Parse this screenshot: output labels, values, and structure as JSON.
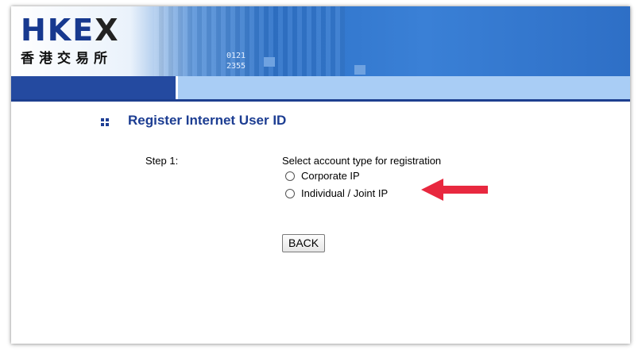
{
  "header": {
    "logo_text": "HKE",
    "logo_x": "X",
    "logo_chinese": "香港交易所",
    "ticker_line1": "0121",
    "ticker_line2": "2355"
  },
  "page": {
    "title": "Register Internet User ID",
    "step_label": "Step 1:",
    "prompt": "Select account type for registration",
    "options": [
      {
        "label": "Corporate IP",
        "selected": false
      },
      {
        "label": "Individual / Joint IP",
        "selected": false
      }
    ],
    "back_label": "BACK"
  },
  "colors": {
    "brand_blue": "#1c3d92",
    "nav_dark": "#244aa0",
    "nav_light": "#a9cdf5",
    "annotation_arrow": "#e8283f"
  }
}
